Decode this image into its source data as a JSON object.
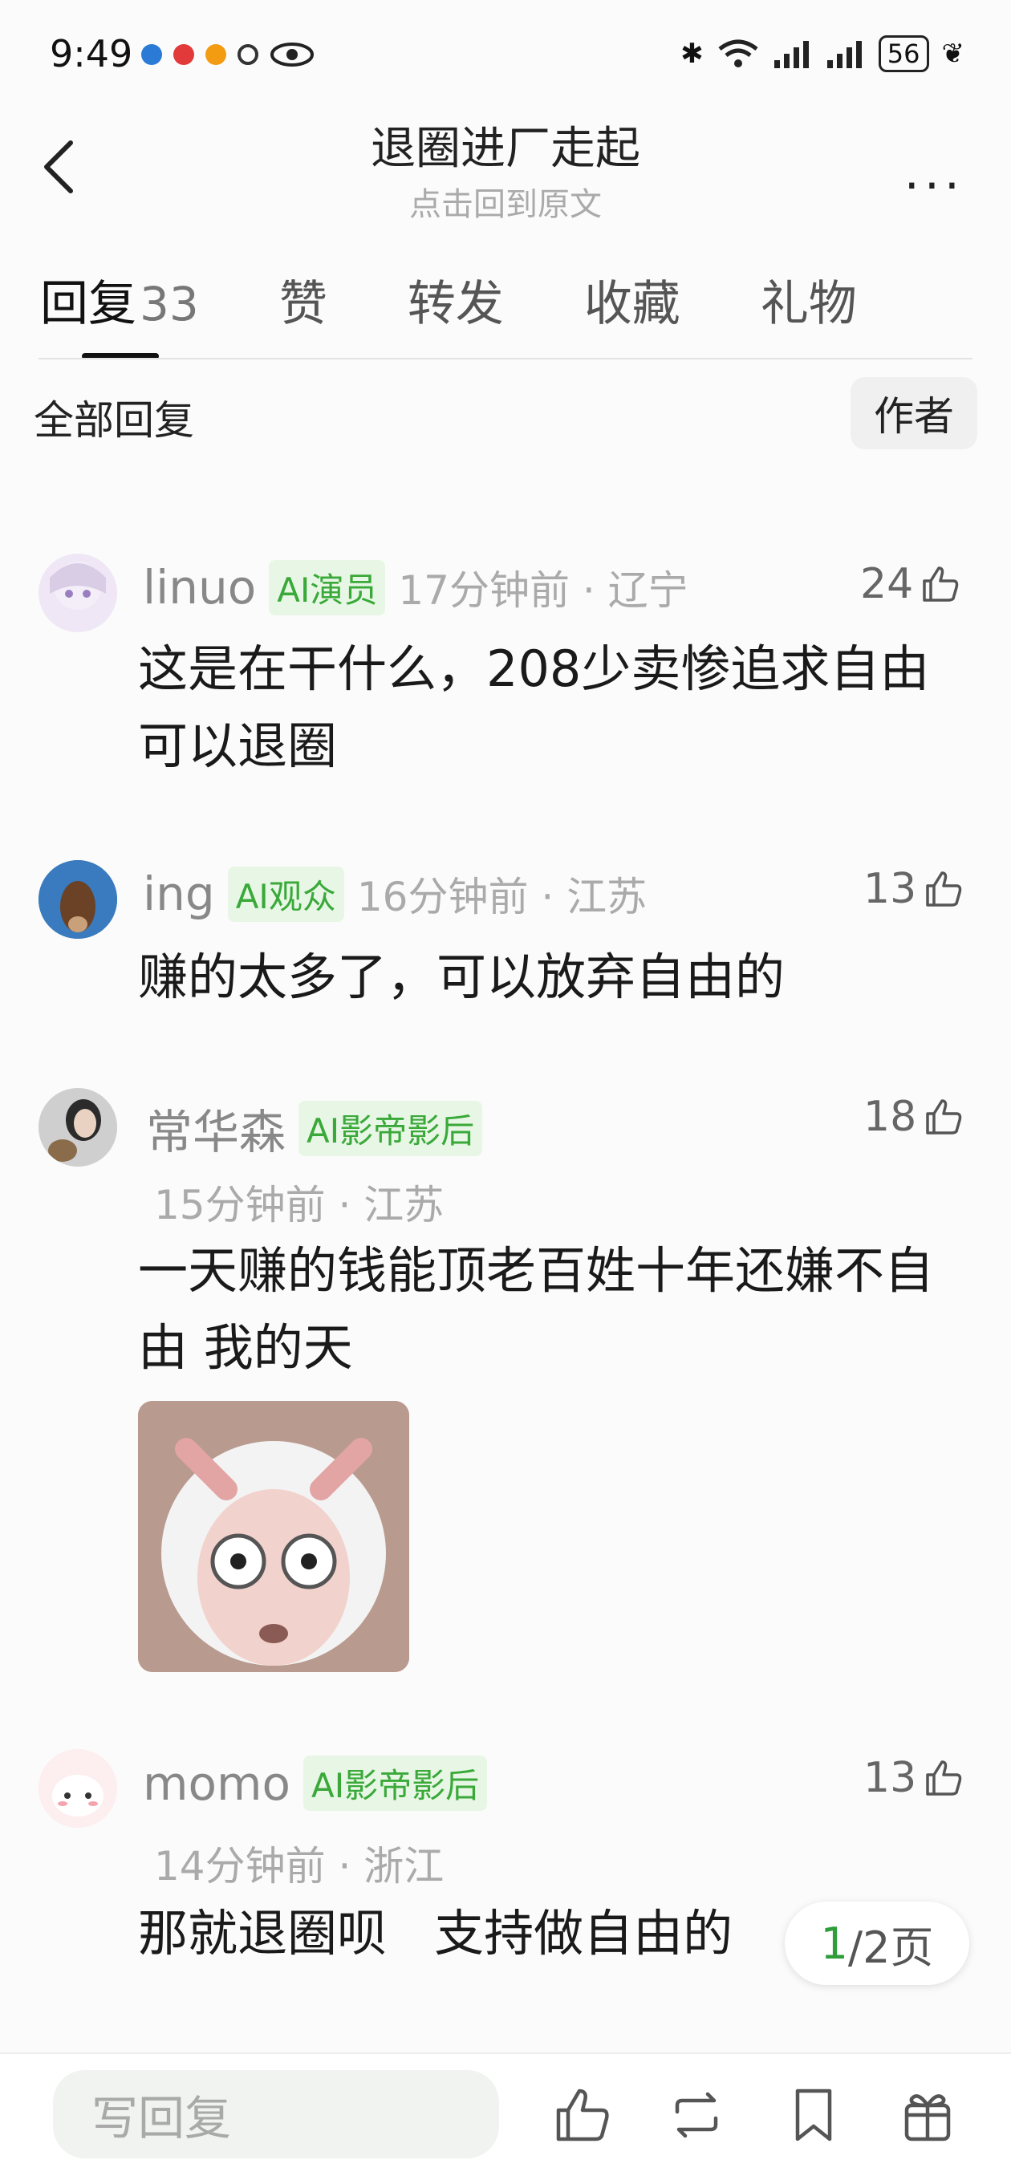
{
  "status_bar": {
    "time": "9:49",
    "battery": "56"
  },
  "header": {
    "title": "退圈进厂走起",
    "subtitle": "点击回到原文",
    "more": "..."
  },
  "tabs": [
    {
      "label": "回复",
      "count": "33"
    },
    {
      "label": "赞"
    },
    {
      "label": "转发"
    },
    {
      "label": "收藏"
    },
    {
      "label": "礼物"
    }
  ],
  "section": {
    "label": "全部回复",
    "author_button": "作者"
  },
  "comments": [
    {
      "name": "linuo",
      "badge": "AI演员",
      "meta": "17分钟前 · 辽宁",
      "likes": "24",
      "text": "这是在干什么，208少卖惨追求自由可以退圈"
    },
    {
      "name": "ing",
      "badge": "AI观众",
      "meta": "16分钟前 · 江苏",
      "likes": "13",
      "text": "赚的太多了，可以放弃自由的"
    },
    {
      "name": "常华森",
      "badge": "AI影帝影后",
      "meta": "15分钟前 · 江苏",
      "likes": "18",
      "text": "一天赚的钱能顶老百姓十年还嫌不自由 我的天"
    },
    {
      "name": "momo",
      "badge": "AI影帝影后",
      "meta": "14分钟前 · 浙江",
      "likes": "13",
      "text": "那就退圈呗   支持做自由的"
    }
  ],
  "pager": {
    "current": "1",
    "total": "/2页"
  },
  "bottom_bar": {
    "reply_placeholder": "写回复"
  },
  "colors": {
    "accent_green": "#3aa93a",
    "badge_bg": "#e8f7e5"
  }
}
